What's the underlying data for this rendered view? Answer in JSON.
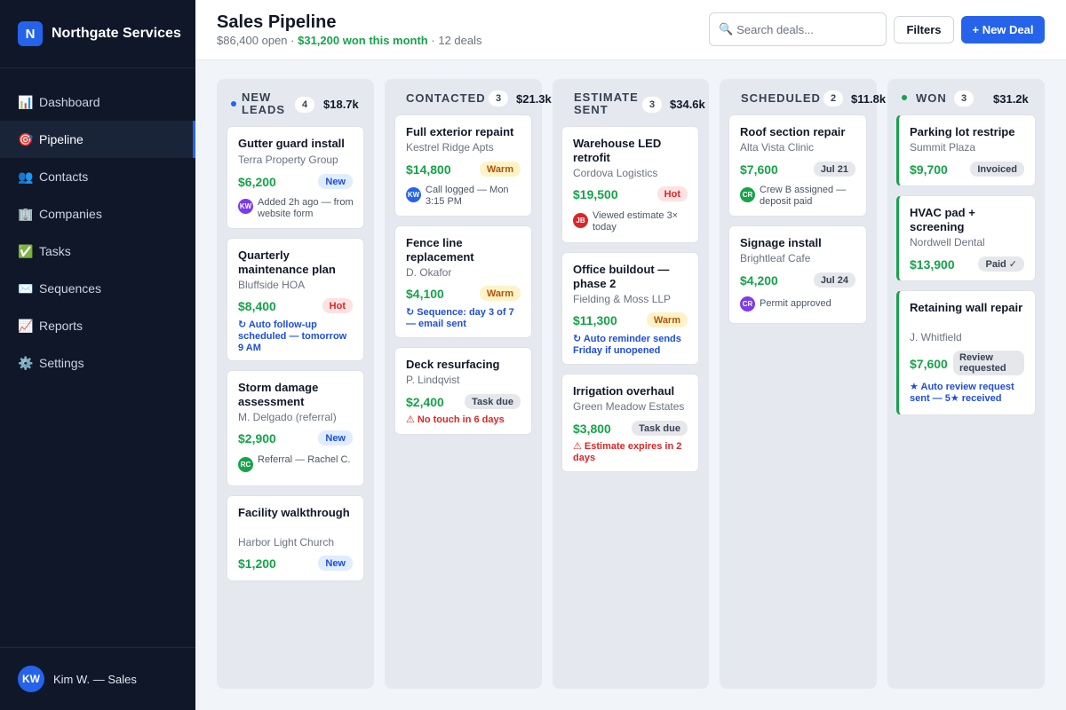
{
  "brand": {
    "logo_letter": "N",
    "name": "Northgate Services"
  },
  "nav": [
    {
      "icon": "📊",
      "label": "Dashboard"
    },
    {
      "icon": "🎯",
      "label": "Pipeline"
    },
    {
      "icon": "👥",
      "label": "Contacts"
    },
    {
      "icon": "🏢",
      "label": "Companies"
    },
    {
      "icon": "✅",
      "label": "Tasks"
    },
    {
      "icon": "✉️",
      "label": "Sequences"
    },
    {
      "icon": "📈",
      "label": "Reports"
    },
    {
      "icon": "⚙️",
      "label": "Settings"
    }
  ],
  "user": {
    "initials": "KW",
    "name": "Kim W. — Sales"
  },
  "header": {
    "title": "Sales Pipeline",
    "open": "$86,400 open",
    "won_month": "$31,200 won this month",
    "deals": "12 deals",
    "search_placeholder": "Search deals...",
    "filters_label": "Filters",
    "new_deal_label": "+ New Deal"
  },
  "colors": {
    "accent": "#2563eb",
    "won": "#16a34a",
    "hot": "#dc2626",
    "warm": "#b45309"
  },
  "columns": [
    {
      "title": "NEW LEADS",
      "count": "4",
      "total": "$18.7k",
      "cards": [
        {
          "title": "Gutter guard install",
          "client": "Terra Property Group",
          "amount": "$6,200",
          "badge": "New",
          "note": "Added 2h ago — from website form",
          "av": "KW"
        },
        {
          "title": "Quarterly maintenance plan",
          "client": "Bluffside HOA",
          "amount": "$8,400",
          "badge": "Hot",
          "note": "↻ Auto follow-up scheduled — tomorrow 9 AM"
        },
        {
          "title": "Storm damage assessment",
          "client": "M. Delgado (referral)",
          "amount": "$2,900",
          "badge": "New",
          "note": "Referral — Rachel C.",
          "av": "RC"
        },
        {
          "title": "Facility walkthrough",
          "client": "Harbor Light Church",
          "amount": "$1,200",
          "badge": "New"
        }
      ]
    },
    {
      "title": "CONTACTED",
      "count": "3",
      "total": "$21.3k",
      "cards": [
        {
          "title": "Full exterior repaint",
          "client": "Kestrel Ridge Apts",
          "amount": "$14,800",
          "badge": "Warm",
          "note": "Call logged — Mon 3:15 PM",
          "av": "KW"
        },
        {
          "title": "Fence line replacement",
          "client": "D. Okafor",
          "amount": "$4,100",
          "badge": "Warm",
          "note": "↻ Sequence: day 3 of 7 — email sent"
        },
        {
          "title": "Deck resurfacing",
          "client": "P. Lindqvist",
          "amount": "$2,400",
          "badge": "Task due",
          "note": "⚠ No touch in 6 days"
        }
      ]
    },
    {
      "title": "ESTIMATE SENT",
      "count": "3",
      "total": "$34.6k",
      "cards": [
        {
          "title": "Warehouse LED retrofit",
          "client": "Cordova Logistics",
          "amount": "$19,500",
          "badge": "Hot",
          "note": "Viewed estimate 3× today",
          "av": "JB"
        },
        {
          "title": "Office buildout — phase 2",
          "client": "Fielding & Moss LLP",
          "amount": "$11,300",
          "badge": "Warm",
          "note": "↻ Auto reminder sends Friday if unopened"
        },
        {
          "title": "Irrigation overhaul",
          "client": "Green Meadow Estates",
          "amount": "$3,800",
          "badge": "Task due",
          "note": "⚠ Estimate expires in 2 days"
        }
      ]
    },
    {
      "title": "SCHEDULED",
      "count": "2",
      "total": "$11.8k",
      "cards": [
        {
          "title": "Roof section repair",
          "client": "Alta Vista Clinic",
          "amount": "$7,600",
          "badge": "Jul 21",
          "note": "Crew B assigned — deposit paid",
          "av": "CR"
        },
        {
          "title": "Signage install",
          "client": "Brightleaf Cafe",
          "amount": "$4,200",
          "badge": "Jul 24",
          "note": "Permit approved",
          "av": "CR"
        }
      ]
    },
    {
      "title": "WON",
      "count": "3",
      "total": "$31.2k",
      "cards": [
        {
          "title": "Parking lot restripe",
          "client": "Summit Plaza",
          "amount": "$9,700",
          "badge": "Invoiced"
        },
        {
          "title": "HVAC pad + screening",
          "client": "Nordwell Dental",
          "amount": "$13,900",
          "badge": "Paid ✓"
        },
        {
          "title": "Retaining wall repair",
          "client": "J. Whitfield",
          "amount": "$7,600",
          "badge": "Review requested",
          "note": "★ Auto review request sent — 5★ received"
        }
      ]
    }
  ]
}
